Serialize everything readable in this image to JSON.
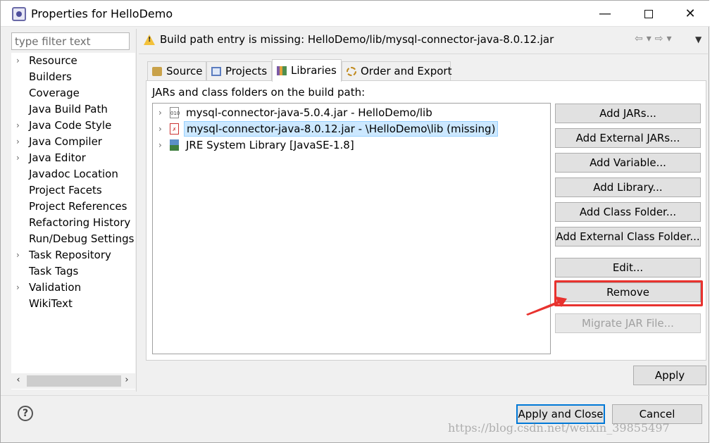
{
  "window": {
    "title": "Properties for HelloDemo"
  },
  "filter": {
    "placeholder": "type filter text"
  },
  "tree": {
    "items": [
      {
        "label": "Resource",
        "expandable": true
      },
      {
        "label": "Builders",
        "expandable": false
      },
      {
        "label": "Coverage",
        "expandable": false
      },
      {
        "label": "Java Build Path",
        "expandable": false
      },
      {
        "label": "Java Code Style",
        "expandable": true
      },
      {
        "label": "Java Compiler",
        "expandable": true
      },
      {
        "label": "Java Editor",
        "expandable": true
      },
      {
        "label": "Javadoc Location",
        "expandable": false
      },
      {
        "label": "Project Facets",
        "expandable": false
      },
      {
        "label": "Project References",
        "expandable": false
      },
      {
        "label": "Refactoring History",
        "expandable": false
      },
      {
        "label": "Run/Debug Settings",
        "expandable": false
      },
      {
        "label": "Task Repository",
        "expandable": true
      },
      {
        "label": "Task Tags",
        "expandable": false
      },
      {
        "label": "Validation",
        "expandable": true
      },
      {
        "label": "WikiText",
        "expandable": false
      }
    ]
  },
  "header": {
    "message": "Build path entry is missing: HelloDemo/lib/mysql-connector-java-8.0.12.jar"
  },
  "tabs": [
    {
      "label": "Source",
      "active": false
    },
    {
      "label": "Projects",
      "active": false
    },
    {
      "label": "Libraries",
      "active": true
    },
    {
      "label": "Order and Export",
      "active": false
    }
  ],
  "libraries": {
    "label": "JARs and class folders on the build path:",
    "entries": [
      {
        "text": "mysql-connector-java-5.0.4.jar - HelloDemo/lib",
        "icon": "jar-icon",
        "selected": false
      },
      {
        "text": "mysql-connector-java-8.0.12.jar - \\HelloDemo\\lib (missing)",
        "icon": "missing-jar-icon",
        "selected": true
      },
      {
        "text": "JRE System Library [JavaSE-1.8]",
        "icon": "jre-library-icon",
        "selected": false
      }
    ]
  },
  "buttons": {
    "add_jars": "Add JARs...",
    "add_external_jars": "Add External JARs...",
    "add_variable": "Add Variable...",
    "add_library": "Add Library...",
    "add_class_folder": "Add Class Folder...",
    "add_external_class_folder": "Add External Class Folder...",
    "edit": "Edit...",
    "remove": "Remove",
    "migrate_jar": "Migrate JAR File...",
    "apply": "Apply",
    "apply_and_close": "Apply and Close",
    "cancel": "Cancel"
  },
  "watermark": "https://blog.csdn.net/weixin_39855497",
  "colors": {
    "accent": "#0078d7",
    "annotation": "#e8322e",
    "selection": "#cce8ff"
  }
}
